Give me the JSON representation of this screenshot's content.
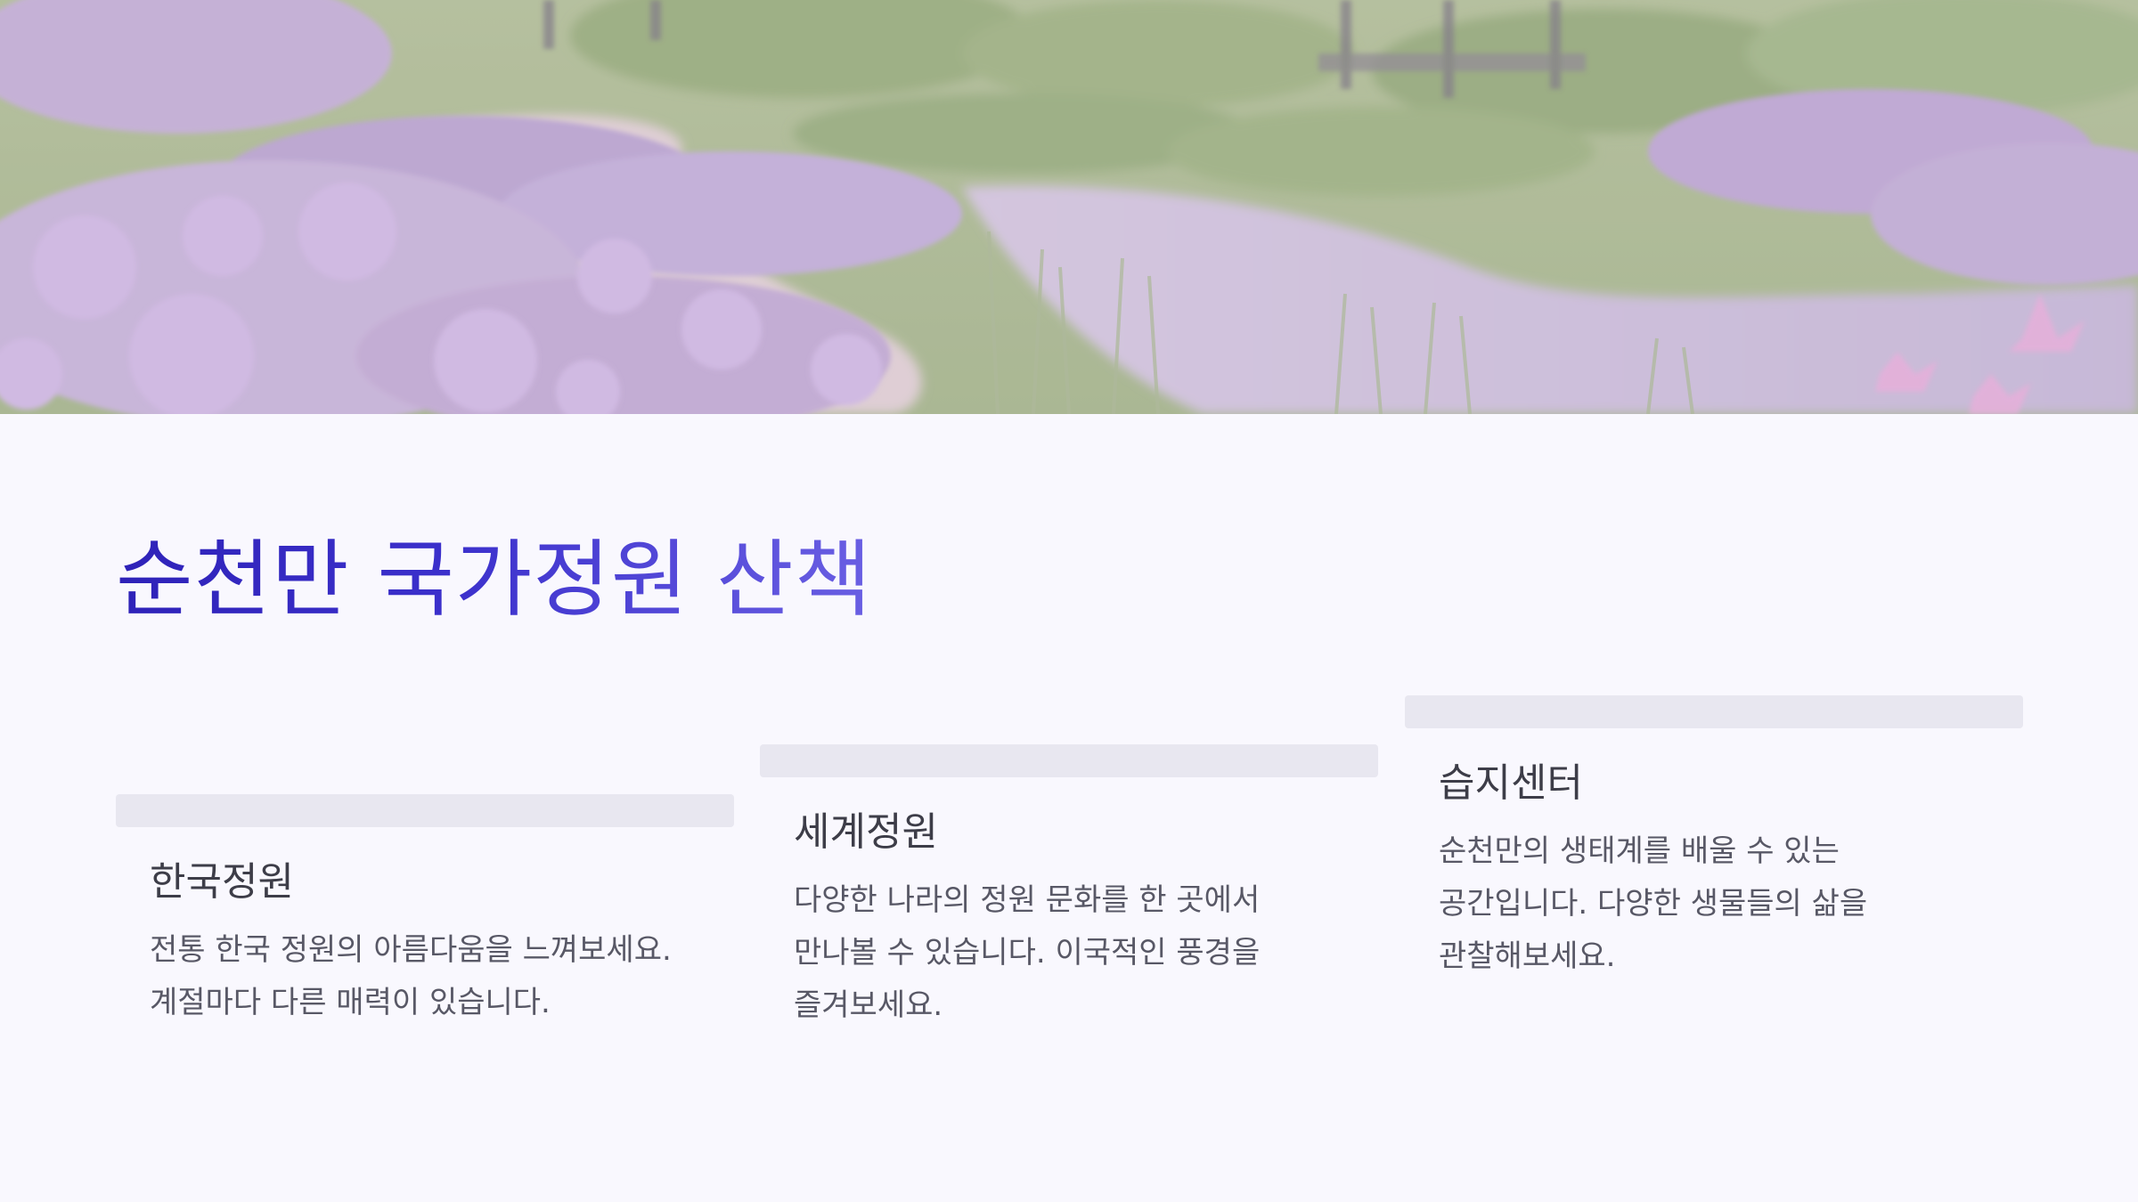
{
  "slide": {
    "title": "순천만 국가정원 산책",
    "hero_image": "garden-landscape-image"
  },
  "cards": [
    {
      "title": "한국정원",
      "description": "전통 한국 정원의 아름다움을 느껴보세요. 계절마다 다른 매력이 있습니다."
    },
    {
      "title": "세계정원",
      "description": "다양한 나라의 정원 문화를 한 곳에서 만나볼 수 있습니다. 이국적인 풍경을 즐겨보세요."
    },
    {
      "title": "습지센터",
      "description": "순천만의 생태계를 배울 수 있는 공간입니다. 다양한 생물들의 삶을 관찰해보세요."
    }
  ],
  "colors": {
    "background": "#f9f8fe",
    "title_gradient_start": "#2e22b8",
    "title_gradient_end": "#6a5fe3",
    "card_bar": "#e8e7f0",
    "text": "#585866"
  }
}
